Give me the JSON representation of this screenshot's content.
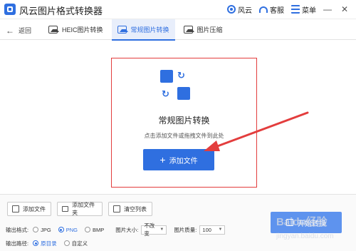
{
  "app": {
    "title": "风云图片格式转换器",
    "user_label": "风云",
    "service_label": "客服",
    "menu_label": "菜单"
  },
  "nav": {
    "back_label": "返回",
    "tabs": [
      {
        "label": "HEIC图片转换",
        "icon": "heic-image-icon",
        "active": false
      },
      {
        "label": "常规图片转换",
        "icon": "image-icon",
        "active": true
      },
      {
        "label": "图片压缩",
        "icon": "compress-image-icon",
        "active": false
      }
    ]
  },
  "drop_zone": {
    "title": "常规图片转换",
    "hint": "点击添加文件或拖拽文件到此处",
    "add_button": "添加文件"
  },
  "toolbar": {
    "add_file": "添加文件",
    "add_folder": "添加文件夹",
    "clear_list": "清空列表"
  },
  "output": {
    "format_label": "输出格式:",
    "formats": [
      "JPG",
      "PNG",
      "BMP"
    ],
    "selected_format": "PNG",
    "size_label": "图片大小:",
    "size_value": "不改变",
    "quality_label": "图片质量:",
    "quality_value": "100",
    "path_label": "输出路径:",
    "path_options": [
      "原目录",
      "自定义"
    ],
    "selected_path": "原目录",
    "start_button": "开始转换"
  },
  "watermark": {
    "text": "Baidu经验",
    "sub": "jingyan.baidu.com"
  },
  "colors": {
    "accent": "#2f6fe0",
    "annotation": "#e33d3d"
  }
}
